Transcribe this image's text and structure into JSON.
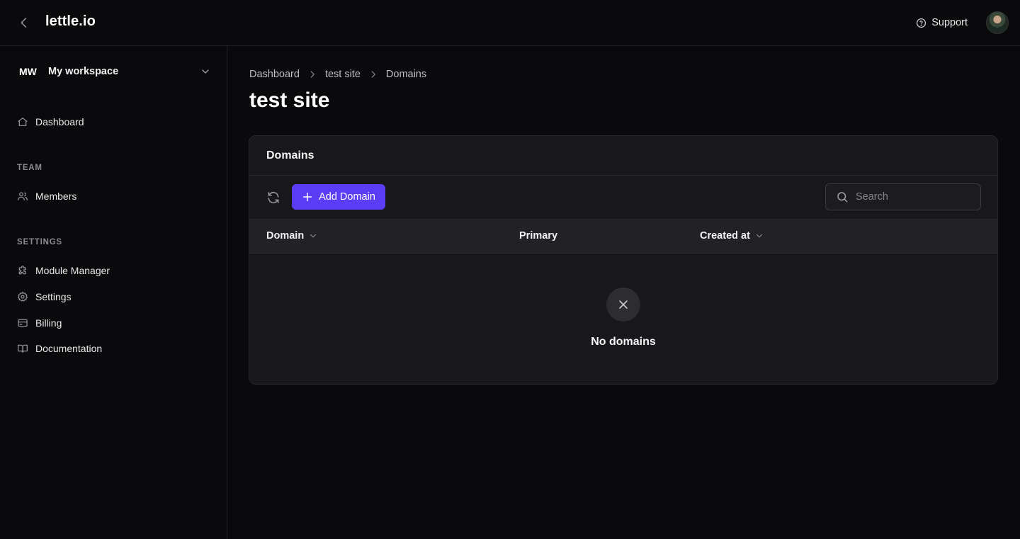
{
  "header": {
    "brand": "lettle.io",
    "support_label": "Support"
  },
  "sidebar": {
    "workspace": {
      "initials": "MW",
      "name": "My workspace"
    },
    "dashboard_label": "Dashboard",
    "sections": [
      {
        "label": "TEAM",
        "items": [
          {
            "label": "Members",
            "icon": "users-icon"
          }
        ]
      },
      {
        "label": "SETTINGS",
        "items": [
          {
            "label": "Module Manager",
            "icon": "puzzle-icon"
          },
          {
            "label": "Settings",
            "icon": "gear-icon"
          },
          {
            "label": "Billing",
            "icon": "credit-card-icon"
          },
          {
            "label": "Documentation",
            "icon": "book-icon"
          }
        ]
      }
    ]
  },
  "main": {
    "breadcrumb": [
      "Dashboard",
      "test site",
      "Domains"
    ],
    "title": "test site",
    "card": {
      "title": "Domains",
      "add_button": "Add Domain",
      "search_placeholder": "Search",
      "columns": [
        "Domain",
        "Primary",
        "Created at"
      ],
      "empty_text": "No domains"
    }
  },
  "colors": {
    "background": "#0a0a0c",
    "card": "#18181b",
    "accent": "#5b3df5"
  }
}
